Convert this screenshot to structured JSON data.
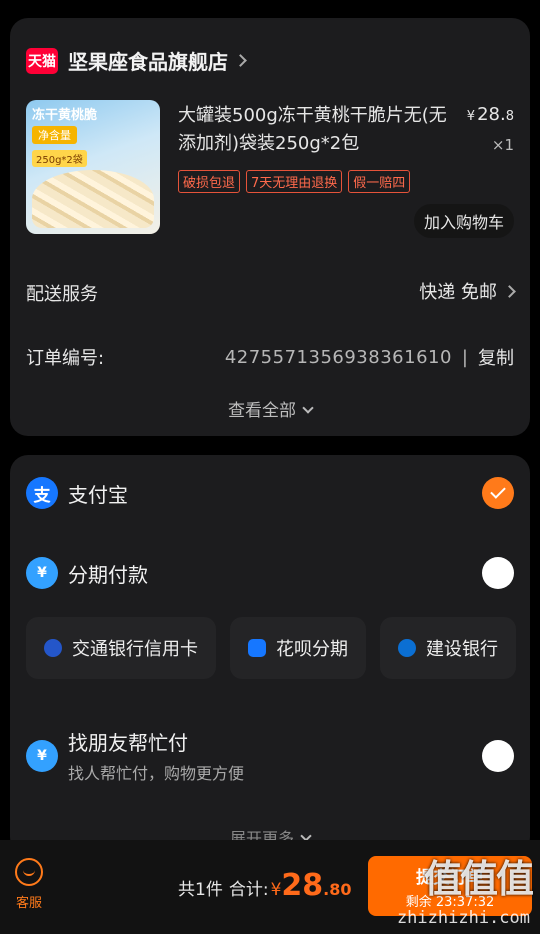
{
  "store": {
    "badge": "天猫",
    "name": "坚果座食品旗舰店"
  },
  "product": {
    "image_title": "冻干黄桃脆",
    "image_tag": "净含量",
    "image_weight": "250g*2袋",
    "title": "大罐装500g冻干黄桃干脆片无(无添加剂)袋装250g*2包",
    "price_symbol": "¥",
    "price_int": "28.",
    "price_dec": "8",
    "qty": "×1",
    "tags": [
      "破损包退",
      "7天无理由退换",
      "假一赔四"
    ],
    "add_to_cart": "加入购物车"
  },
  "delivery": {
    "label": "配送服务",
    "value": "快递 免邮"
  },
  "order": {
    "label": "订单编号:",
    "number": "4275571356938361610",
    "separator": "|",
    "copy": "复制"
  },
  "view_all": "查看全部",
  "payment": {
    "alipay": {
      "icon": "支",
      "label": "支付宝",
      "selected": true
    },
    "installment": {
      "icon": "¥",
      "label": "分期付款"
    },
    "options": [
      "交通银行信用卡",
      "花呗分期",
      "建设银行"
    ],
    "friend_pay": {
      "icon": "¥",
      "label": "找朋友帮忙付",
      "sub": "找人帮忙付，购物更方便"
    },
    "expand": "展开更多"
  },
  "bottom": {
    "service_label": "客服",
    "count_text": "共1件",
    "total_label": "合计:",
    "total_symbol": "¥",
    "total_int": "28",
    "total_dec": ".80",
    "submit_label": "提交订单",
    "countdown": "剩余 23:37:32",
    "watermark": "值值值",
    "watermark_url": "zhizhizhi.com"
  },
  "colors": {
    "accent": "#ff6a00",
    "selected": "#ff7a1a",
    "tag": "#ff6a4c",
    "brand": "#ff0036",
    "alipay": "#1677ff"
  }
}
